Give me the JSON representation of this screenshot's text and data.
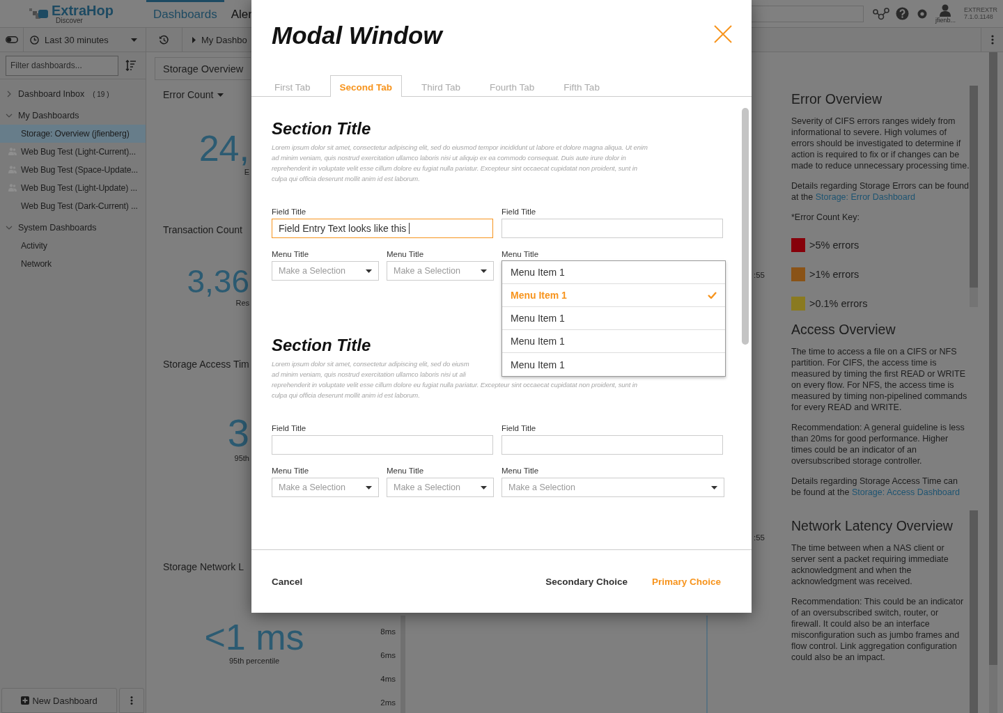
{
  "topbar": {
    "logo": {
      "name": "ExtraHop",
      "tagline": "Discover"
    },
    "nav": [
      {
        "label": "Dashboards",
        "selected": true
      },
      {
        "label": "Aler",
        "selected": false
      }
    ],
    "user": "jfienb...",
    "appliance": "EXTREXTR",
    "version": "7.1.0.1148"
  },
  "toolbar": {
    "time_range": "Last 30 minutes",
    "breadcrumb": "My Dashbo"
  },
  "sidebar": {
    "filter": {
      "placeholder": "Filter dashboards..."
    },
    "tree": [
      {
        "label": "Dashboard Inbox",
        "count": "( 19 )",
        "expanded": false
      },
      {
        "label": "My Dashboards",
        "expanded": true,
        "children": [
          {
            "label": "Storage: Overview (jfienberg)",
            "selected": true,
            "shared": false
          },
          {
            "label": "Web Bug Test (Light-Current)...",
            "selected": false,
            "shared": true
          },
          {
            "label": "Web Bug Test (Space-Update...",
            "selected": false,
            "shared": true
          },
          {
            "label": "Web Bug Test (Light-Update) ...",
            "selected": false,
            "shared": true
          },
          {
            "label": "Web Bug Test (Dark-Current) ...",
            "selected": false,
            "shared": false
          }
        ]
      },
      {
        "label": "System Dashboards",
        "expanded": true,
        "children": [
          {
            "label": "Activity",
            "selected": false,
            "shared": false
          },
          {
            "label": "Network",
            "selected": false,
            "shared": false
          }
        ]
      }
    ],
    "new_button": "New Dashboard"
  },
  "main": {
    "tab": "Storage Overview",
    "widgets": [
      {
        "title": "Error Count",
        "menu": true,
        "value": "24,",
        "caption": "E"
      },
      {
        "title": "Transaction Count",
        "menu": false,
        "value": "3,36",
        "caption": "Res"
      },
      {
        "title": "Storage Access Tim",
        "menu": false,
        "value": "3",
        "caption": "95th"
      },
      {
        "title": "Storage Network L",
        "menu": false,
        "value": "<1 ms",
        "caption": "95th percentile"
      }
    ],
    "chart_ticks": [
      "8ms",
      "6ms",
      "4ms",
      "2ms"
    ],
    "axis_labels": [
      ":55",
      ":55"
    ]
  },
  "info_panel": {
    "sections": [
      {
        "title": "Error Overview",
        "paragraphs": [
          {
            "text": "Severity of CIFS errors ranges widely from informational to severe. High volumes of errors should be investigated to determine if action is required to fix or if changes can be made to reduce unnecessary processing time."
          },
          {
            "text": "Details regarding Storage Errors can be found at the ",
            "link": "Storage: Error Dashboard"
          },
          {
            "text": "*Error Count Key:"
          }
        ],
        "legend": [
          {
            "label": ">5% errors",
            "color": "#86000a"
          },
          {
            "label": ">1% errors",
            "color": "#8a5317"
          },
          {
            "label": ">0.1% errors",
            "color": "#8a7a20"
          }
        ]
      },
      {
        "title": "Access Overview",
        "paragraphs": [
          {
            "text": "The time to access a file on a CIFS or NFS partition. For CIFS, the access time is measured by timing the first READ or WRITE on every flow. For NFS, the access time is measured by timing non-pipelined commands for every READ and WRITE."
          },
          {
            "text": "Recommendation: A general guideline is less than 20ms for good performance. Higher times could be an indicator of an oversubscribed storage controller."
          },
          {
            "text": "Details regarding Storage Access Time can be found at the ",
            "link": "Storage: Access Dashboard"
          }
        ]
      },
      {
        "title": "Network Latency Overview",
        "paragraphs": [
          {
            "text": "The time between when a NAS client or server sent a packet requiring immediate acknowledgment and when the acknowledgment was received."
          },
          {
            "text": "Recommendation: This could be an indicator of an oversubscribed switch, router, or firewall. It could also be an interface misconfiguration such as jumbo frames and flow control. Link aggregation configuration could also be an impact."
          }
        ]
      }
    ]
  },
  "modal": {
    "title": "Modal Window",
    "tabs": [
      {
        "label": "First Tab",
        "selected": false
      },
      {
        "label": "Second Tab",
        "selected": true
      },
      {
        "label": "Third Tab",
        "selected": false
      },
      {
        "label": "Fourth Tab",
        "selected": false
      },
      {
        "label": "Fifth Tab",
        "selected": false
      }
    ],
    "sections": [
      {
        "title": "Section Title",
        "lines": [
          "Lorem ipsum dolor sit amet, consectetur adipiscing elit, sed do eiusmod tempor incididunt ut labore et dolore magna aliqua. Ut enim",
          "ad minim veniam, quis nostrud exercitation ullamco laboris nisi ut aliquip ex ea commodo consequat. Duis aute irure dolor in",
          "reprehenderit in voluptate velit esse cillum dolore eu fugiat nulla pariatur. Excepteur sint occaecat cupidatat non proident, sunt in",
          "culpa qui officia deserunt mollit anim id est laborum."
        ],
        "fields": [
          {
            "label": "Field Title",
            "value": "Field Entry Text looks like this",
            "focused": true
          },
          {
            "label": "Field Title",
            "focused": false
          }
        ],
        "menus": [
          {
            "label": "Menu Title",
            "placeholder": "Make a Selection",
            "open": false
          },
          {
            "label": "Menu Title",
            "placeholder": "Make a Selection",
            "open": false
          },
          {
            "label": "Menu Title",
            "open": true,
            "items": [
              {
                "label": "Menu Item 1",
                "selected": false
              },
              {
                "label": "Menu Item 1",
                "selected": true
              },
              {
                "label": "Menu Item 1",
                "selected": false
              },
              {
                "label": "Menu Item 1",
                "selected": false
              },
              {
                "label": "Menu Item 1",
                "selected": false
              }
            ]
          }
        ]
      },
      {
        "title": "Section Title",
        "lines": [
          "Lorem ipsum dolor sit amet, consectetur adipiscing elit, sed do eiusm",
          "ad minim veniam, quis nostrud exercitation ullamco laboris nisi ut ali",
          "reprehenderit in voluptate velit esse cillum dolore eu fugiat nulla pariatur. Excepteur sint occaecat cupidatat non proident, sunt in",
          "culpa qui officia deserunt mollit anim id est laborum."
        ],
        "fields": [
          {
            "label": "Field Title",
            "focused": false
          },
          {
            "label": "Field Title",
            "focused": false
          }
        ],
        "menus": [
          {
            "label": "Menu Title",
            "placeholder": "Make a Selection",
            "open": false
          },
          {
            "label": "Menu Title",
            "placeholder": "Make a Selection",
            "open": false
          },
          {
            "label": "Menu Title",
            "placeholder": "Make a Selection",
            "open": false
          }
        ]
      }
    ],
    "buttons": [
      {
        "label": "Cancel",
        "kind": "cancel"
      },
      {
        "label": "Secondary Choice",
        "kind": "secondary"
      },
      {
        "label": "Primary Choice",
        "kind": "primary"
      }
    ]
  }
}
